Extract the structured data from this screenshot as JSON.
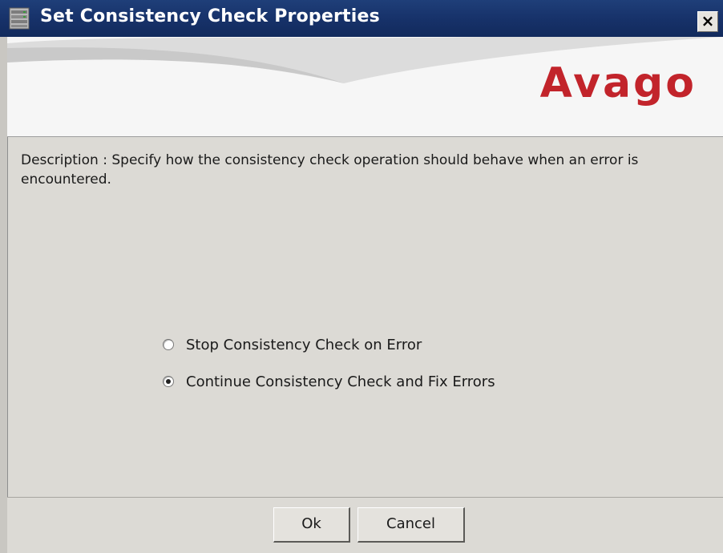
{
  "window": {
    "title": "Set Consistency Check Properties",
    "close_label": "×",
    "app_icon": "server-stack-icon"
  },
  "banner": {
    "logo_text": "Avago",
    "logo_color": "#c2242b"
  },
  "description": "Description : Specify how the consistency check operation should behave when an error is encountered.",
  "options": [
    {
      "label": "Stop Consistency Check on Error",
      "selected": false
    },
    {
      "label": "Continue Consistency Check and Fix Errors",
      "selected": true
    }
  ],
  "footer": {
    "ok_label": "Ok",
    "cancel_label": "Cancel"
  }
}
